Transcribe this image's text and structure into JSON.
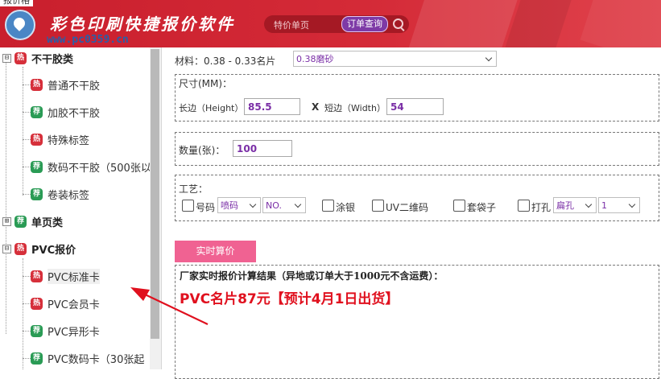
{
  "header": {
    "top_cut_text": "报价格",
    "app_title": "彩色印刷快捷报价软件",
    "watermark": "www.pc0359.cn",
    "search_placeholder": "特价单页",
    "query_button": "订单查询",
    "colors": {
      "header_red": "#c91f2d",
      "query_purple": "#7e3aa6"
    }
  },
  "sidebar": {
    "categories": [
      {
        "expander": "⊟",
        "badge": "热",
        "label": "不干胶类"
      },
      {
        "expander": "⊞",
        "badge": "荐",
        "label": "单页类"
      },
      {
        "expander": "⊟",
        "badge": "热",
        "label": "PVC报价"
      }
    ],
    "items_sticker": [
      {
        "badge": "热",
        "label": "普通不干胶"
      },
      {
        "badge": "荐",
        "label": "加胶不干胶"
      },
      {
        "badge": "热",
        "label": "特殊标签"
      },
      {
        "badge": "荐",
        "label": "数码不干胶（500张以"
      },
      {
        "badge": "荐",
        "label": "卷装标签"
      }
    ],
    "items_pvc": [
      {
        "badge": "热",
        "label": "PVC标准卡"
      },
      {
        "badge": "热",
        "label": "PVC会员卡"
      },
      {
        "badge": "荐",
        "label": "PVC异形卡"
      },
      {
        "badge": "荐",
        "label": "PVC数码卡（30张起"
      }
    ]
  },
  "form": {
    "material_label": "材料：0.38 - 0.33名片",
    "material_value": "0.38磨砂",
    "size_label": "尺寸(MM)：",
    "long_label": "长边（Height）",
    "long_value": "85.5",
    "times": "X",
    "short_label": "短边（Width）",
    "short_value": "54",
    "qty_label": "数量(张)：",
    "qty_value": "100",
    "craft_label": "工艺：",
    "crafts": {
      "number_label": "号码",
      "number_type": "喷码",
      "number_format": "NO.",
      "silver": "涂银",
      "uv": "UV二维码",
      "sleeve": "套袋子",
      "punch": "打孔",
      "punch_type": "扁孔",
      "punch_count": "1"
    },
    "calc_button": "实时算价",
    "result_title": "厂家实时报价计算结果（异地或订单大于1000元不含运费）：",
    "result_text": "PVC名片87元【预计4月1日出货】"
  }
}
